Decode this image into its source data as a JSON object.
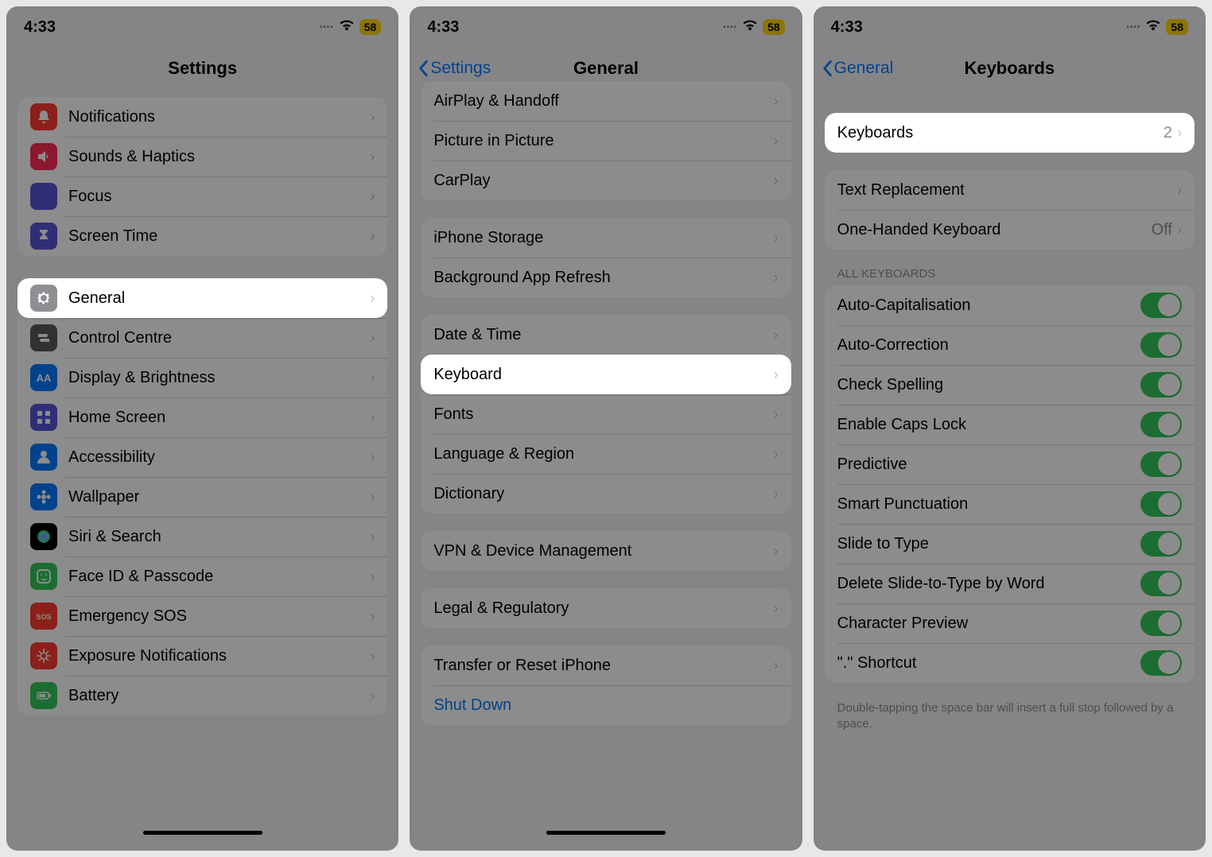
{
  "status": {
    "time": "4:33",
    "battery": "58"
  },
  "screen1": {
    "title": "Settings",
    "groups": [
      {
        "rows": [
          {
            "icon": "bell",
            "color": "ic-red",
            "label": "Notifications"
          },
          {
            "icon": "speaker",
            "color": "ic-pink",
            "label": "Sounds & Haptics"
          },
          {
            "icon": "moon",
            "color": "ic-purple",
            "label": "Focus"
          },
          {
            "icon": "hourglass",
            "color": "ic-purple",
            "label": "Screen Time"
          }
        ]
      },
      {
        "rows": [
          {
            "icon": "gear",
            "color": "ic-grey",
            "label": "General",
            "highlight": true
          },
          {
            "icon": "switches",
            "color": "ic-darkgrey",
            "label": "Control Centre"
          },
          {
            "icon": "aa",
            "color": "ic-blue",
            "label": "Display & Brightness"
          },
          {
            "icon": "grid",
            "color": "ic-purple",
            "label": "Home Screen"
          },
          {
            "icon": "person",
            "color": "ic-blue",
            "label": "Accessibility"
          },
          {
            "icon": "flower",
            "color": "ic-blue",
            "label": "Wallpaper"
          },
          {
            "icon": "siri",
            "color": "ic-black",
            "label": "Siri & Search"
          },
          {
            "icon": "faceid",
            "color": "ic-green",
            "label": "Face ID & Passcode"
          },
          {
            "icon": "sos",
            "color": "ic-red",
            "label": "Emergency SOS"
          },
          {
            "icon": "virus",
            "color": "ic-red",
            "label": "Exposure Notifications"
          },
          {
            "icon": "battery",
            "color": "ic-green",
            "label": "Battery"
          }
        ]
      }
    ]
  },
  "screen2": {
    "back": "Settings",
    "title": "General",
    "groups": [
      {
        "rows": [
          {
            "label": "AirPlay & Handoff"
          },
          {
            "label": "Picture in Picture"
          },
          {
            "label": "CarPlay"
          }
        ]
      },
      {
        "rows": [
          {
            "label": "iPhone Storage"
          },
          {
            "label": "Background App Refresh"
          }
        ]
      },
      {
        "rows": [
          {
            "label": "Date & Time"
          },
          {
            "label": "Keyboard",
            "highlight": true
          },
          {
            "label": "Fonts"
          },
          {
            "label": "Language & Region"
          },
          {
            "label": "Dictionary"
          }
        ]
      },
      {
        "rows": [
          {
            "label": "VPN & Device Management"
          }
        ]
      },
      {
        "rows": [
          {
            "label": "Legal & Regulatory"
          }
        ]
      },
      {
        "rows": [
          {
            "label": "Transfer or Reset iPhone"
          },
          {
            "label": "Shut Down",
            "link": true
          }
        ]
      }
    ]
  },
  "screen3": {
    "back": "General",
    "title": "Keyboards",
    "top_row": {
      "label": "Keyboards",
      "value": "2",
      "highlight": true
    },
    "group2": [
      {
        "label": "Text Replacement",
        "chevron": true
      },
      {
        "label": "One-Handed Keyboard",
        "value": "Off",
        "chevron": true
      }
    ],
    "section_header": "ALL KEYBOARDS",
    "toggles": [
      "Auto-Capitalisation",
      "Auto-Correction",
      "Check Spelling",
      "Enable Caps Lock",
      "Predictive",
      "Smart Punctuation",
      "Slide to Type",
      "Delete Slide-to-Type by Word",
      "Character Preview",
      "\".\" Shortcut"
    ],
    "footer": "Double-tapping the space bar will insert a full stop followed by a space."
  }
}
